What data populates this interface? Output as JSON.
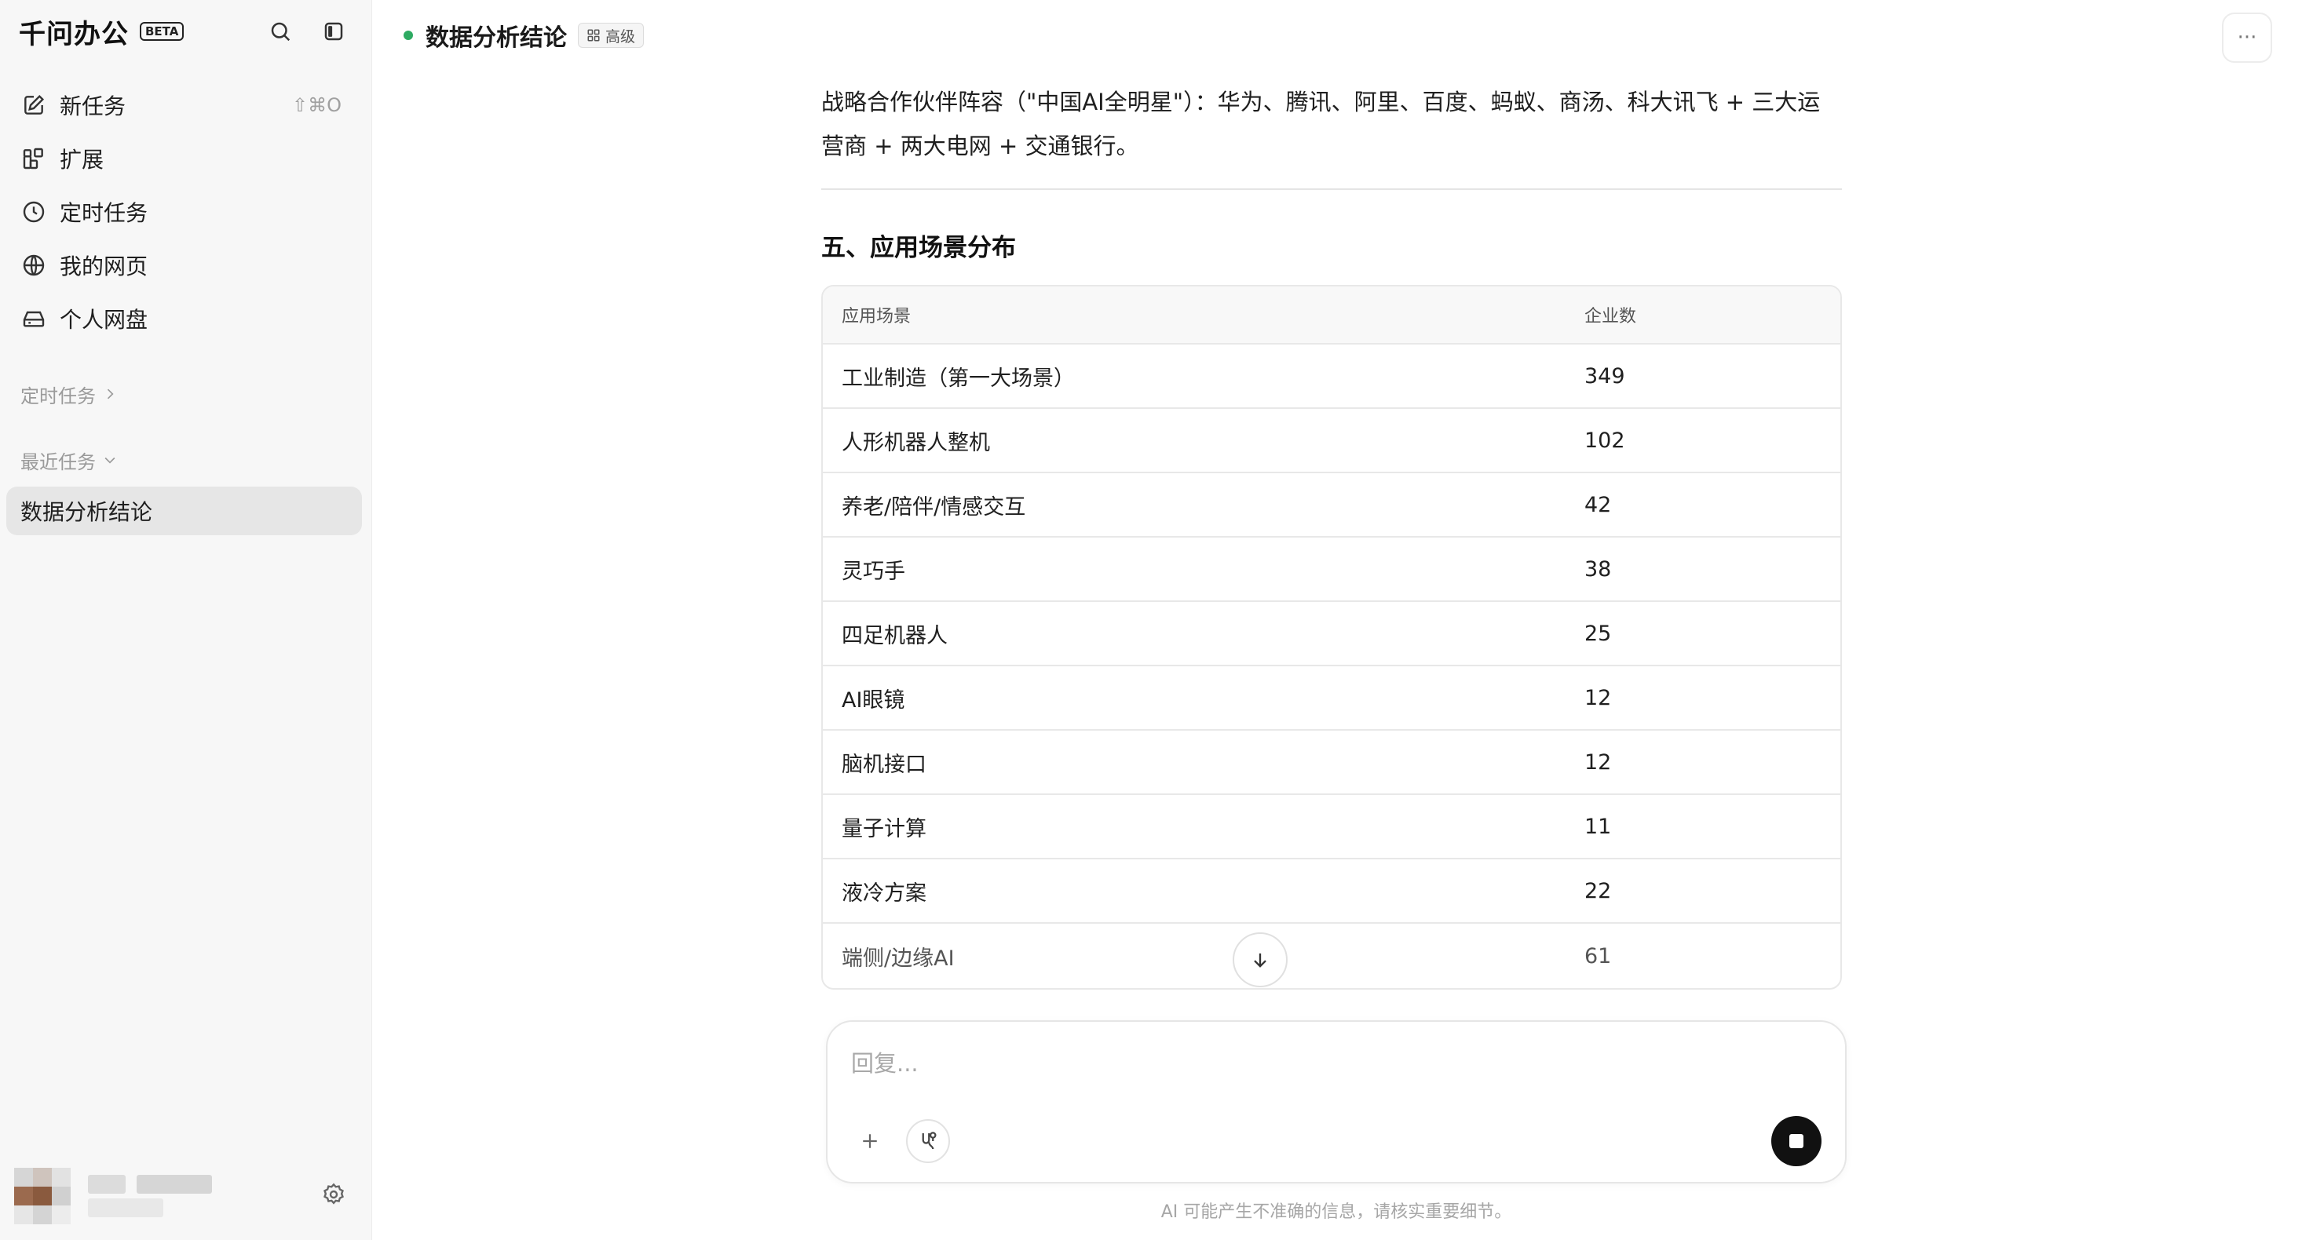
{
  "sidebar": {
    "brand": "千问办公",
    "beta": "BETA",
    "nav": [
      {
        "label": "新任务",
        "icon": "edit-icon",
        "shortcut": "⇧⌘O"
      },
      {
        "label": "扩展",
        "icon": "extensions-icon"
      },
      {
        "label": "定时任务",
        "icon": "clock-icon"
      },
      {
        "label": "我的网页",
        "icon": "globe-icon"
      },
      {
        "label": "个人网盘",
        "icon": "drive-icon"
      }
    ],
    "section_scheduled": "定时任务",
    "section_recent": "最近任务",
    "recent_items": [
      "数据分析结论"
    ]
  },
  "header": {
    "title": "数据分析结论",
    "tag": "高级",
    "more": "···"
  },
  "content": {
    "paragraph": "战略合作伙伴阵容（\"中国AI全明星\"）：华为、腾讯、阿里、百度、蚂蚁、商汤、科大讯飞 + 三大运营商 + 两大电网 + 交通银行。",
    "heading": "五、应用场景分布",
    "table": {
      "headers": [
        "应用场景",
        "企业数"
      ],
      "rows": [
        [
          "工业制造（第一大场景）",
          "349"
        ],
        [
          "人形机器人整机",
          "102"
        ],
        [
          "养老/陪伴/情感交互",
          "42"
        ],
        [
          "灵巧手",
          "38"
        ],
        [
          "四足机器人",
          "25"
        ],
        [
          "AI眼镜",
          "12"
        ],
        [
          "脑机接口",
          "12"
        ],
        [
          "量子计算",
          "11"
        ],
        [
          "液冷方案",
          "22"
        ],
        [
          "端侧/边缘AI",
          "61"
        ]
      ]
    }
  },
  "composer": {
    "placeholder": "回复..."
  },
  "disclaimer": "AI 可能产生不准确的信息，请核实重要细节。",
  "colors": {
    "status_dot": "#2eaa62",
    "sidebar_bg": "#f7f7f7",
    "selected_bg": "#e6e6e6",
    "stop_button": "#111111"
  }
}
